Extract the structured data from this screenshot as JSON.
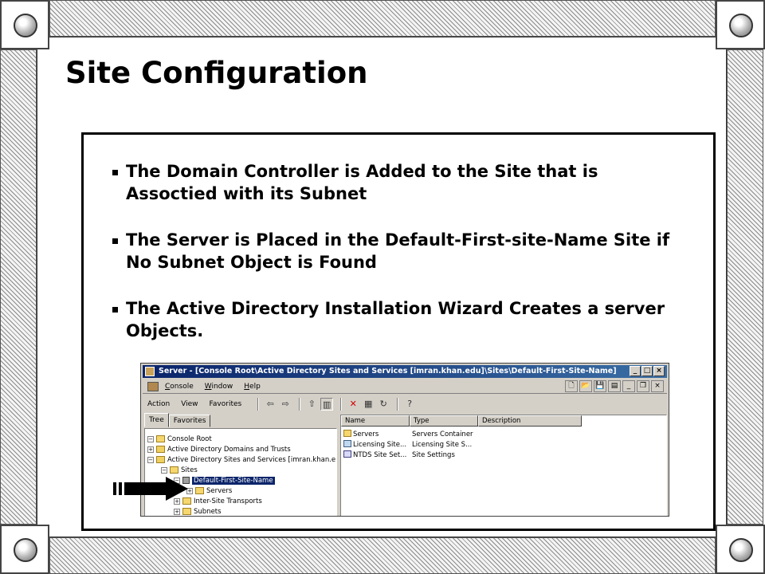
{
  "slide": {
    "title": "Site Configuration",
    "bullets": [
      "The Domain Controller is Added to the Site that is Assoctied with its Subnet",
      "The Server is Placed in the Default-First-site-Name Site if No Subnet Object is Found",
      "The Active Directory Installation Wizard Creates a server Objects."
    ]
  },
  "screenshot": {
    "window_title": "Server - [Console Root\\Active Directory Sites and Services [imran.khan.edu]\\Sites\\Default-First-Site-Name]",
    "window_buttons": [
      "_",
      "□",
      "×"
    ],
    "menu1": [
      "Console",
      "Window",
      "Help"
    ],
    "menu1_mnemonics": [
      "C",
      "W",
      "H"
    ],
    "menu2": [
      "Action",
      "View",
      "Favorites"
    ],
    "tabs": [
      "Tree",
      "Favorites"
    ],
    "tree": [
      {
        "label": "Console Root",
        "toggle": "−",
        "icon": "root"
      },
      {
        "label": "Active Directory Domains and Trusts",
        "toggle": "+",
        "icon": "domains"
      },
      {
        "label": "Active Directory Sites and Services [imran.khan.e",
        "toggle": "−",
        "icon": "sites"
      },
      {
        "label": "Sites",
        "toggle": "−",
        "icon": "folder"
      },
      {
        "label": "Default-First-Site-Name",
        "toggle": "−",
        "icon": "site",
        "selected": true
      },
      {
        "label": "Servers",
        "toggle": "+",
        "icon": "folder"
      },
      {
        "label": "Inter-Site Transports",
        "toggle": "+",
        "icon": "folder"
      },
      {
        "label": "Subnets",
        "toggle": "+",
        "icon": "folder"
      }
    ],
    "columns": [
      "Name",
      "Type",
      "Description"
    ],
    "rows": [
      {
        "name": "Servers",
        "type": "Servers Container",
        "description": ""
      },
      {
        "name": "Licensing Site...",
        "type": "Licensing Site S...",
        "description": ""
      },
      {
        "name": "NTDS Site Set...",
        "type": "Site Settings",
        "description": ""
      }
    ]
  },
  "icons": {
    "pointer": "arrow-right-icon",
    "corner": "rivet-icon",
    "bullet": "square-bullet-icon"
  },
  "colors": {
    "titlebar_start": "#0a246a",
    "titlebar_end": "#3a6ea5",
    "window_face": "#d4d0c8"
  }
}
